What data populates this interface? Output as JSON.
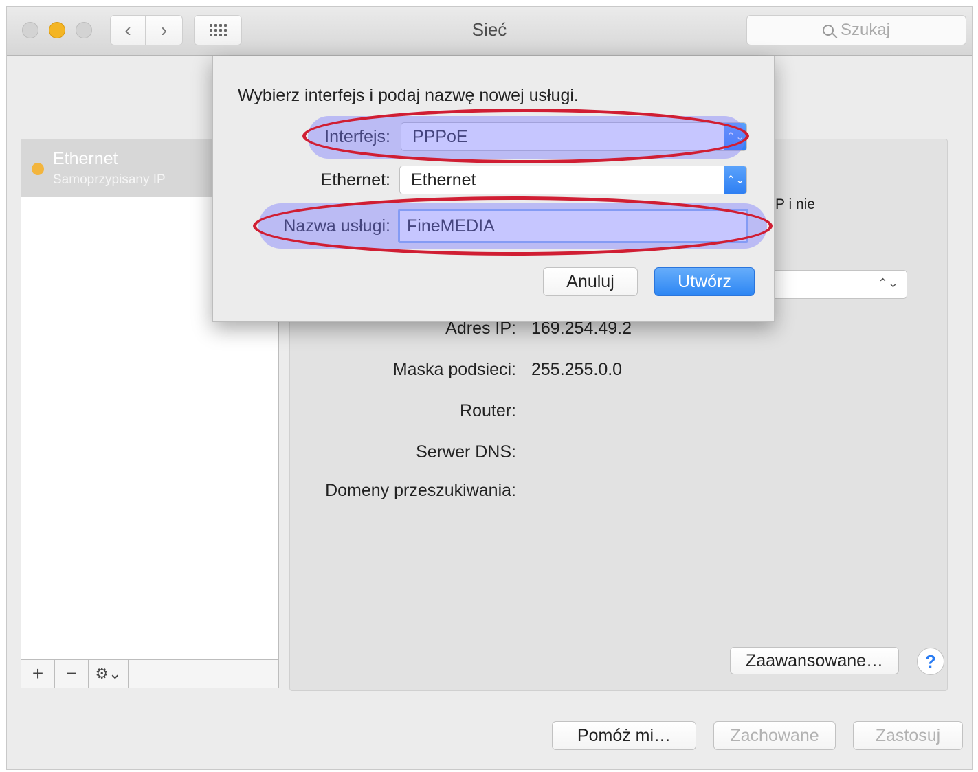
{
  "window": {
    "title": "Sieć",
    "search_placeholder": "Szukaj"
  },
  "sidebar": {
    "items": [
      {
        "name": "Ethernet",
        "subtitle": "Samoprzypisany IP"
      }
    ],
    "add_label": "+",
    "remove_label": "−",
    "gear_label": "⚙⌄"
  },
  "detail": {
    "partial_text": "P i nie",
    "fields": [
      {
        "label": "Adres IP:",
        "value": "169.254.49.2"
      },
      {
        "label": "Maska podsieci:",
        "value": "255.255.0.0"
      },
      {
        "label": "Router:",
        "value": ""
      },
      {
        "label": "Serwer DNS:",
        "value": ""
      },
      {
        "label": "Domeny przeszukiwania:",
        "value": ""
      }
    ],
    "advanced_label": "Zaawansowane…",
    "help_label": "?"
  },
  "footer": {
    "assist_label": "Pomóż mi…",
    "revert_label": "Zachowane",
    "apply_label": "Zastosuj"
  },
  "sheet": {
    "prompt": "Wybierz interfejs i podaj nazwę nowej usługi.",
    "interface_label": "Interfejs:",
    "interface_value": "PPPoE",
    "ethernet_label": "Ethernet:",
    "ethernet_value": "Ethernet",
    "service_label": "Nazwa usługi:",
    "service_value": "FineMEDIA",
    "cancel_label": "Anuluj",
    "create_label": "Utwórz"
  },
  "colors": {
    "accent": "#2d86f3",
    "annotation_ring": "#d01e33",
    "highlight": "#7878ff",
    "status_dot": "#f3b53d"
  }
}
